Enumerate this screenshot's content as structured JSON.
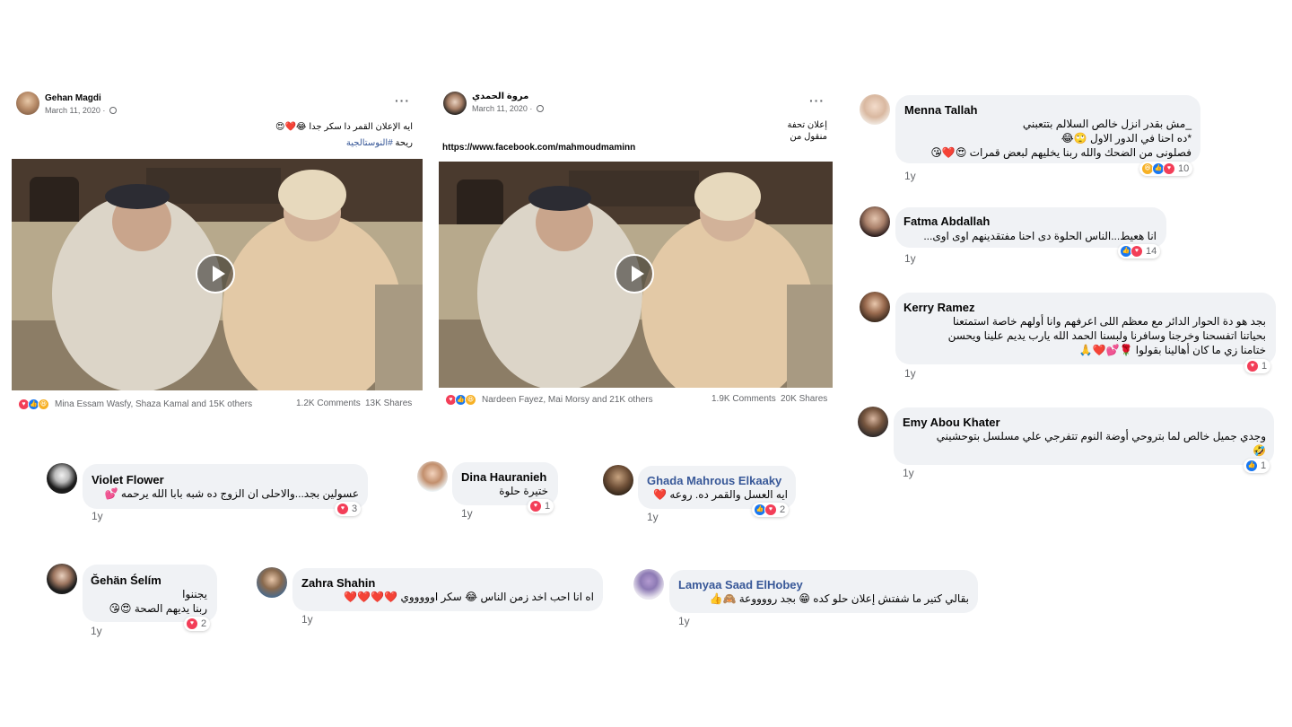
{
  "post1": {
    "author": "Gehan Magdi",
    "date": "March 11, 2020 ·",
    "more": "···",
    "text_line1": "ايه الإعلان القمر دا سكر جدا 😂❤️😍",
    "text_line2_prefix": "ريحة ",
    "hashtag": "#النوستالجية",
    "reactions_names": "Mina Essam Wasfy, Shaza Kamal and 15K others",
    "comments": "1.2K Comments",
    "shares": "13K Shares"
  },
  "post2": {
    "author": "مروة الحمدي",
    "date": "March 11, 2020 ·",
    "more": "···",
    "text_line1": "إعلان تحفة",
    "text_line2": "منقول من",
    "link": "https://www.facebook.com/mahmoudmaminn",
    "reactions_names": "Nardeen Fayez, Mai Morsy and 21K others",
    "comments": "1.9K Comments",
    "shares": "20K Shares"
  },
  "comments": [
    {
      "name": "Menna Tallah",
      "lines": [
        "_مش بقدر انزل خالص السلالم بتتعبني",
        "*ده احنا في الدور الاول 🙄😂",
        "فصلونى من الضحك والله ربنا يخليهم لبعض قمرات 😍❤️😘"
      ],
      "reaction_count": "10",
      "time": "1y"
    },
    {
      "name": "Fatma Abdallah",
      "lines": [
        "انا هعيط...الناس الحلوة دى احنا مفتقدينهم اوى اوى..."
      ],
      "reaction_count": "14",
      "time": "1y"
    },
    {
      "name": "Kerry Ramez",
      "lines": [
        "بجد هو دة الحوار الدائر مع معظم اللى اعرفهم وانا أولهم خاصة استمتعنا",
        "بحياتنا اتفسحنا وخرجنا وسافرنا ولبسنا الحمد الله يارب يديم علينا ويحسن",
        "ختامنا زي ما كان أهالينا بقولوا 🌹💕❤️🙏"
      ],
      "reaction_count": "1",
      "time": "1y"
    },
    {
      "name": "Emy Abou Khater",
      "lines": [
        "وجدي جميل خالص لما بتروحي أوضة النوم تتفرجي علي مسلسل بتوحشيني",
        "🤣"
      ],
      "reaction_count": "1",
      "time": "1y"
    },
    {
      "name": "Violet Flower",
      "lines": [
        "عسولين بجد...والاحلى ان الزوج ده شبه بابا الله يرحمه 💕"
      ],
      "reaction_count": "3",
      "time": "1y"
    },
    {
      "name": "Dina Hauranieh",
      "lines": [
        "ختيرة حلوة"
      ],
      "reaction_count": "1",
      "time": "1y"
    },
    {
      "name": "Ghada Mahrous Elkaaky",
      "lines": [
        "ايه العسل والقمر ده. روعه ❤️"
      ],
      "reaction_count": "2",
      "time": "1y"
    },
    {
      "name": "Ğehän Śelím",
      "lines": [
        "يجننوا",
        "ربنا يديهم الصحة 😍😘"
      ],
      "reaction_count": "2",
      "time": "1y"
    },
    {
      "name": "Zahra Shahin",
      "lines": [
        "اه انا احب اخد زمن الناس 😂 سكر اوووووي ❤️❤️❤️❤️"
      ],
      "reaction_count": "",
      "time": "1y"
    },
    {
      "name": "Lamyaa Saad ElHobey",
      "lines": [
        "بقالي كتير ما شفتش إعلان حلو كده 😁 بجد رووووعة 🙈👍"
      ],
      "reaction_count": "",
      "time": "1y"
    }
  ]
}
